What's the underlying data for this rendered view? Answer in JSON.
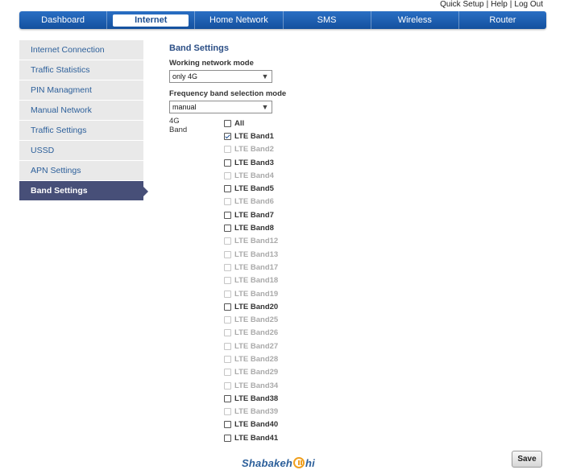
{
  "top_links": {
    "quick_setup": "Quick Setup",
    "help": "Help",
    "logout": "Log Out",
    "separator": "|"
  },
  "nav": [
    {
      "label": "Dashboard",
      "active": false
    },
    {
      "label": "Internet",
      "active": true
    },
    {
      "label": "Home Network",
      "active": false
    },
    {
      "label": "SMS",
      "active": false
    },
    {
      "label": "Wireless",
      "active": false
    },
    {
      "label": "Router",
      "active": false
    }
  ],
  "sidebar": [
    {
      "label": "Internet Connection",
      "active": false
    },
    {
      "label": "Traffic Statistics",
      "active": false
    },
    {
      "label": "PIN Managment",
      "active": false
    },
    {
      "label": "Manual Network",
      "active": false
    },
    {
      "label": "Traffic Settings",
      "active": false
    },
    {
      "label": "USSD",
      "active": false
    },
    {
      "label": "APN Settings",
      "active": false
    },
    {
      "label": "Band Settings",
      "active": true
    }
  ],
  "content": {
    "title": "Band Settings",
    "network_mode": {
      "label": "Working network mode",
      "value": "only 4G"
    },
    "freq_mode": {
      "label": "Frequency band selection mode",
      "value": "manual"
    },
    "band_label": "4G Band"
  },
  "bands": [
    {
      "label": "All",
      "checked": false,
      "disabled": false
    },
    {
      "label": "LTE Band1",
      "checked": true,
      "disabled": false
    },
    {
      "label": "LTE Band2",
      "checked": false,
      "disabled": true
    },
    {
      "label": "LTE Band3",
      "checked": false,
      "disabled": false
    },
    {
      "label": "LTE Band4",
      "checked": false,
      "disabled": true
    },
    {
      "label": "LTE Band5",
      "checked": false,
      "disabled": false
    },
    {
      "label": "LTE Band6",
      "checked": false,
      "disabled": true
    },
    {
      "label": "LTE Band7",
      "checked": false,
      "disabled": false
    },
    {
      "label": "LTE Band8",
      "checked": false,
      "disabled": false
    },
    {
      "label": "LTE Band12",
      "checked": false,
      "disabled": true
    },
    {
      "label": "LTE Band13",
      "checked": false,
      "disabled": true
    },
    {
      "label": "LTE Band17",
      "checked": false,
      "disabled": true
    },
    {
      "label": "LTE Band18",
      "checked": false,
      "disabled": true
    },
    {
      "label": "LTE Band19",
      "checked": false,
      "disabled": true
    },
    {
      "label": "LTE Band20",
      "checked": false,
      "disabled": false
    },
    {
      "label": "LTE Band25",
      "checked": false,
      "disabled": true
    },
    {
      "label": "LTE Band26",
      "checked": false,
      "disabled": true
    },
    {
      "label": "LTE Band27",
      "checked": false,
      "disabled": true
    },
    {
      "label": "LTE Band28",
      "checked": false,
      "disabled": true
    },
    {
      "label": "LTE Band29",
      "checked": false,
      "disabled": true
    },
    {
      "label": "LTE Band34",
      "checked": false,
      "disabled": true
    },
    {
      "label": "LTE Band38",
      "checked": false,
      "disabled": false
    },
    {
      "label": "LTE Band39",
      "checked": false,
      "disabled": true
    },
    {
      "label": "LTE Band40",
      "checked": false,
      "disabled": false
    },
    {
      "label": "LTE Band41",
      "checked": false,
      "disabled": false
    }
  ],
  "logo": {
    "text_before": "Shabakeh",
    "text_after": "hi",
    "icon": "signal-circle-icon"
  },
  "save_label": "Save",
  "colors": {
    "nav_blue": "#14509e",
    "active_side": "#474f78",
    "link_blue": "#2c5f9a",
    "logo_accent": "#f0a020"
  }
}
